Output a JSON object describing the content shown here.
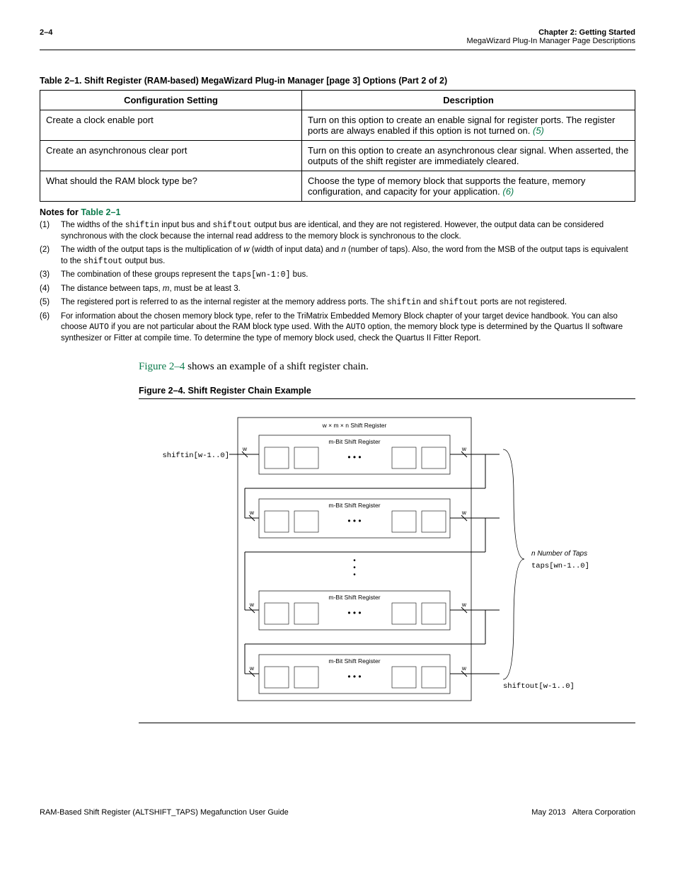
{
  "header": {
    "pageNum": "2–4",
    "chapter": "Chapter 2:",
    "chapterTitle": "Getting Started",
    "subtitle": "MegaWizard Plug-In Manager Page Descriptions"
  },
  "table": {
    "caption": "Table 2–1.  Shift Register (RAM-based) MegaWizard Plug-in Manager [page 3] Options   (Part 2 of 2)",
    "col1": "Configuration Setting",
    "col2": "Description",
    "rows": [
      {
        "setting": "Create a clock enable port",
        "desc": "Turn on this option to create an enable signal for register ports. The register ports are always enabled if this option is not turned on.  ",
        "note": "(5)"
      },
      {
        "setting": "Create an asynchronous clear port",
        "desc": "Turn on this option to create an asynchronous clear signal. When asserted, the outputs of the shift register are immediately cleared.",
        "note": ""
      },
      {
        "setting": "What should the RAM block type be?",
        "desc": "Choose the type of memory block that supports the feature, memory configuration, and capacity for your application. ",
        "note": "(6)"
      }
    ]
  },
  "notes": {
    "title_prefix": "Notes for ",
    "title_link": "Table 2–1",
    "items": {
      "n1a": "The widths of the ",
      "n1m1": "shiftin",
      "n1b": " input bus and ",
      "n1m2": "shiftout",
      "n1c": " output bus are identical, and they are not registered. However, the output data can be considered synchronous with the clock because the internal read address to the memory block is synchronous to the clock.",
      "n2a": "The width of the output taps is the multiplication of ",
      "n2i1": "w",
      "n2b": " (width of input data) and ",
      "n2i2": "n",
      "n2c": " (number of taps). Also, the word from the MSB of the output taps is equivalent to the ",
      "n2m1": "shiftout",
      "n2d": " output bus.",
      "n3a": "The combination of these groups represent the ",
      "n3m1": "taps[wn-1:0]",
      "n3b": " bus.",
      "n4a": "The distance between taps, ",
      "n4i1": "m",
      "n4b": ", must be at least 3.",
      "n5a": "The registered port is referred to as the internal register at the memory address ports. The ",
      "n5m1": "shiftin",
      "n5b": " and ",
      "n5m2": "shiftout",
      "n5c": " ports are not registered.",
      "n6a": "For information about the chosen memory block type, refer to the TriMatrix Embedded Memory Block chapter of your target device handbook. You can also choose ",
      "n6m1": "AUTO",
      "n6b": " if you are not particular about the RAM block type used. With the ",
      "n6m2": "AUTO",
      "n6c": " option, the memory block type is determined by the Quartus II software synthesizer or Fitter at compile time. To determine the type of memory block used, check the Quartus II Fitter Report."
    }
  },
  "body": {
    "figref": "Figure 2–4",
    "text_after": " shows an example of a shift register chain."
  },
  "figure": {
    "caption": "Figure 2–4.  Shift Register Chain Example",
    "top_label": "w × m × n Shift Register",
    "row_label": "m-Bit Shift Register",
    "shiftin": "shiftin[w-1..0]",
    "w": "w",
    "ntaps_it": "n Number of Taps",
    "taps": "taps[wn-1..0]",
    "shiftout": "shiftout[w-1..0]"
  },
  "footer": {
    "left": "RAM-Based Shift Register (ALTSHIFT_TAPS) Megafunction User Guide",
    "right_date": "May 2013",
    "right_corp": "Altera Corporation"
  }
}
